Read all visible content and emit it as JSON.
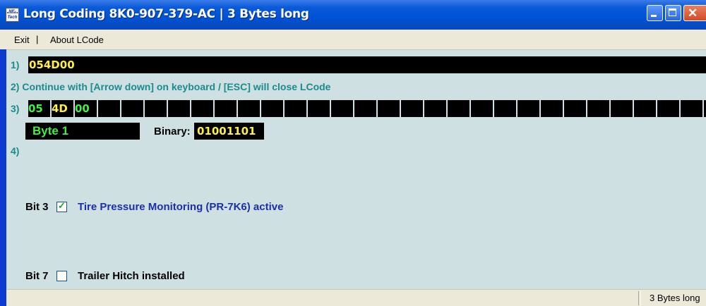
{
  "window": {
    "title": "Long Coding  8K0-907-379-AC  |  3 Bytes long",
    "icon_text": "NE-Tech",
    "close_glyph": "✕"
  },
  "menu": {
    "exit": "Exit",
    "separator": "|",
    "about": "About LCode"
  },
  "steps": {
    "s1": "1)",
    "s2": "2) Continue with [Arrow down] on keyboard / [ESC] will close LCode",
    "s3": "3)",
    "s4": "4)"
  },
  "coding": {
    "value": "054D00"
  },
  "bytes": [
    {
      "value": "05"
    },
    {
      "value": "4D"
    },
    {
      "value": "00"
    }
  ],
  "selected_byte": {
    "label": "Byte 1",
    "binary_label": "Binary:",
    "binary_value": "01001101"
  },
  "bits": [
    {
      "label": "Bit 3",
      "checked": true,
      "description": "Tire Pressure Monitoring (PR-7K6) active",
      "color": "#1a2fa8"
    },
    {
      "label": "Bit 7",
      "checked": false,
      "description": "Trailer Hitch installed",
      "color": "#000000"
    }
  ],
  "status": {
    "text": "3 Bytes long"
  },
  "colors": {
    "accent_teal": "#1a8c8c",
    "value_yellow": "#ffee44",
    "value_green": "#44ee44",
    "window_bg": "#cfe0e3",
    "titlebar_blue": "#0052d6"
  }
}
